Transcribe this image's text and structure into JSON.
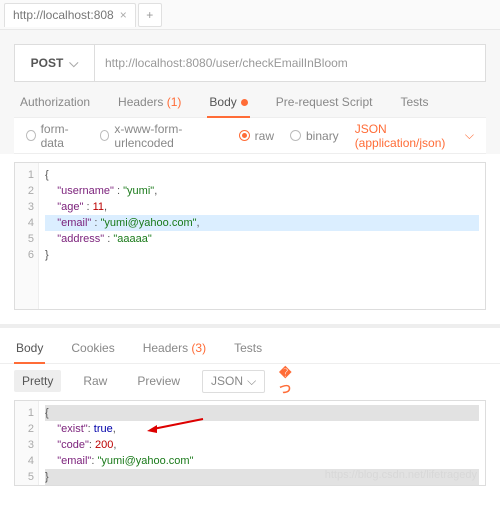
{
  "tab": {
    "title": "http://localhost:808",
    "close": "×",
    "plus": "+"
  },
  "req": {
    "method": "POST",
    "url": "http://localhost:8080/user/checkEmailInBloom",
    "tabs": {
      "auth": "Authorization",
      "headers": "Headers",
      "headers_cnt": "(1)",
      "body": "Body",
      "prereq": "Pre-request Script",
      "tests": "Tests"
    },
    "opts": {
      "formdata": "form-data",
      "urlenc": "x-www-form-urlencoded",
      "raw": "raw",
      "binary": "binary",
      "ctype": "JSON (application/json)"
    },
    "body_lines": {
      "l1": "{",
      "l2_k": "\"username\"",
      "l2_v": "\"yumi\"",
      "l3_k": "\"age\"",
      "l3_v": "11",
      "l4_k": "\"email\"",
      "l4_v": "\"yumi@yahoo.com\"",
      "l5_k": "\"address\"",
      "l5_v": "\"aaaaa\"",
      "l6": "}"
    }
  },
  "resp": {
    "tabs": {
      "body": "Body",
      "cookies": "Cookies",
      "headers": "Headers",
      "headers_cnt": "(3)",
      "tests": "Tests"
    },
    "view": {
      "pretty": "Pretty",
      "raw": "Raw",
      "preview": "Preview",
      "fmt": "JSON"
    },
    "body_lines": {
      "l1": "{",
      "l2_k": "\"exist\"",
      "l2_v": "true",
      "l3_k": "\"code\"",
      "l3_v": "200",
      "l4_k": "\"email\"",
      "l4_v": "\"yumi@yahoo.com\"",
      "l5": "}"
    }
  },
  "wm": "https://blog.csdn.net/lifetragedy",
  "chart_data": {
    "type": "table",
    "request_body": {
      "username": "yumi",
      "age": 11,
      "email": "yumi@yahoo.com",
      "address": "aaaaa"
    },
    "response_body": {
      "exist": true,
      "code": 200,
      "email": "yumi@yahoo.com"
    }
  }
}
